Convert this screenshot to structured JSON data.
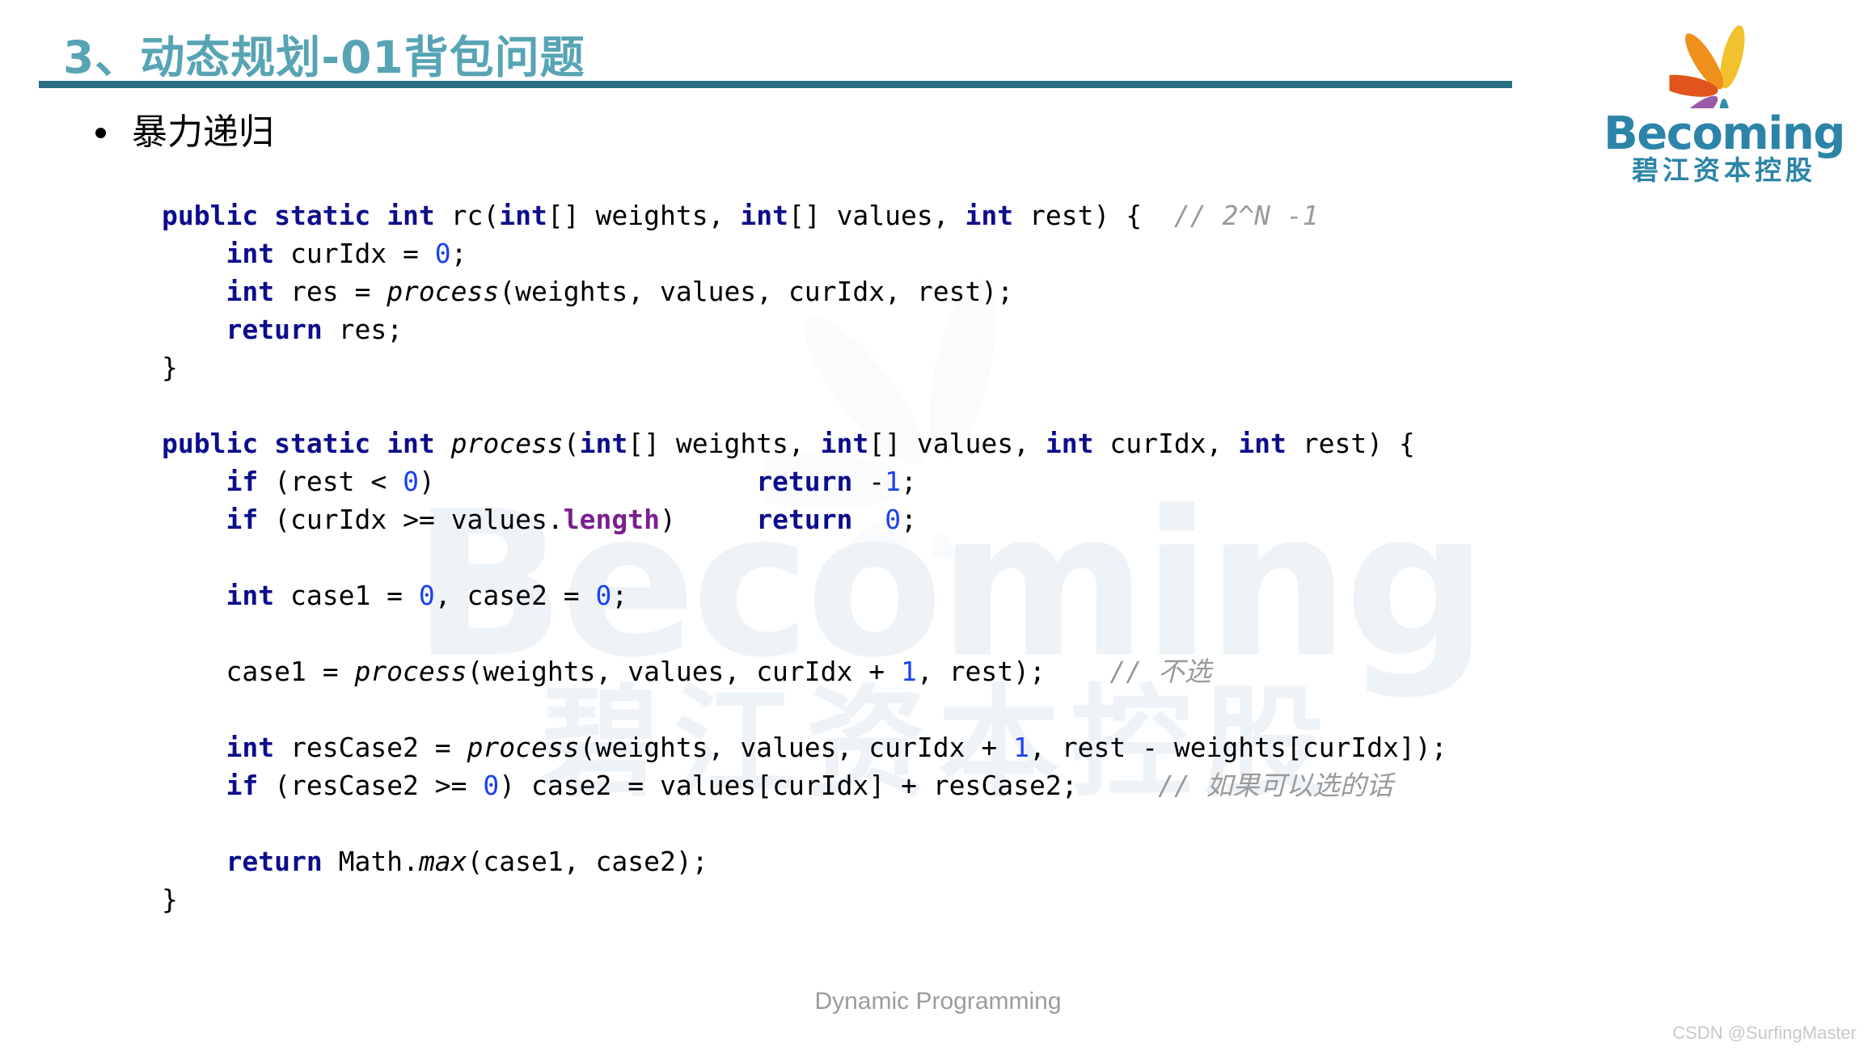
{
  "slide": {
    "title": "3、动态规划-01背包问题",
    "title_color": "#57a4b4",
    "rule_color": "#2a6e83",
    "footer_note": "Dynamic Programming",
    "csdn_watermark": "CSDN @SurfingMaster"
  },
  "logo": {
    "wordmark": "Becoming",
    "chinese": "碧江资本控股",
    "brand_color": "#2c84a8",
    "petal_colors": [
      "#f2c12e",
      "#ef8f1c",
      "#e0551c",
      "#9a5ba6",
      "#2f8fab"
    ]
  },
  "watermark": {
    "wordmark": "Becoming",
    "chinese": "碧江资本控股"
  },
  "bullet": {
    "label": "暴力递归"
  },
  "syntax_colors": {
    "keyword": "#0d0d8c",
    "number": "#1b41f0",
    "field": "#7b1f8f",
    "comment": "#9a9a9a",
    "plain": "#000000"
  },
  "code": {
    "language": "java",
    "lines": [
      "public static int rc(int[] weights, int[] values, int rest) {  // 2^N -1",
      "    int curIdx = 0;",
      "    int res = process(weights, values, curIdx, rest);",
      "    return res;",
      "}",
      "",
      "public static int process(int[] weights, int[] values, int curIdx, int rest) {",
      "    if (rest < 0)                    return -1;",
      "    if (curIdx >= values.length)     return  0;",
      "",
      "    int case1 = 0, case2 = 0;",
      "",
      "    case1 = process(weights, values, curIdx + 1, rest);    // 不选",
      "",
      "    int resCase2 = process(weights, values, curIdx + 1, rest - weights[curIdx]);",
      "    if (resCase2 >= 0) case2 = values[curIdx] + resCase2;     // 如果可以选的话",
      "",
      "    return Math.max(case1, case2);",
      "}"
    ],
    "comments": {
      "complexity": "// 2^N -1",
      "skip": "// 不选",
      "take": "// 如果可以选的话"
    }
  }
}
